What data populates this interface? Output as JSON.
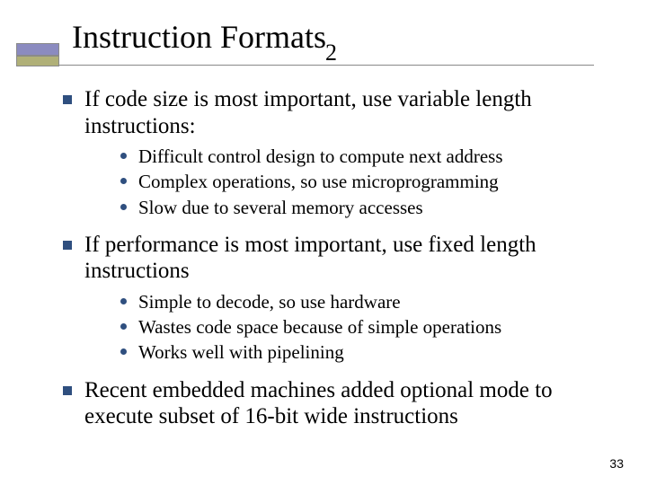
{
  "title": {
    "text": "Instruction Formats",
    "subscript": "2"
  },
  "points": [
    {
      "text": "If code size is most important, use variable length instructions:",
      "sub": [
        "Difficult control design to compute next address",
        "Complex operations, so use microprogramming",
        "Slow due to several memory accesses"
      ]
    },
    {
      "text": "If performance is most important, use fixed length instructions",
      "sub": [
        "Simple to decode, so use hardware",
        "Wastes code space because of simple operations",
        "Works well with pipelining"
      ]
    },
    {
      "text": "Recent embedded machines added optional mode to execute subset of 16-bit wide instructions",
      "sub": []
    }
  ],
  "page_number": "33"
}
